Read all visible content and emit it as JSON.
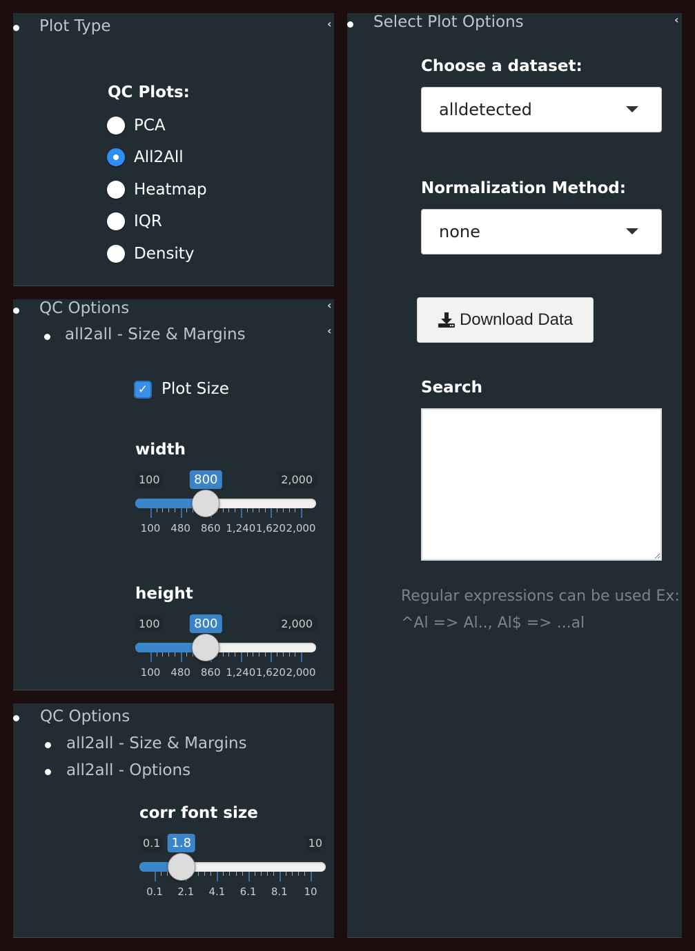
{
  "plot_type_panel": {
    "title": "Plot Type",
    "collapse_icon": "chevron-left-icon",
    "radio_group_label": "QC Plots:",
    "options": [
      {
        "label": "PCA",
        "checked": false
      },
      {
        "label": "All2All",
        "checked": true
      },
      {
        "label": "Heatmap",
        "checked": false
      },
      {
        "label": "IQR",
        "checked": false
      },
      {
        "label": "Density",
        "checked": false
      }
    ]
  },
  "qc_options_panel_1": {
    "title": "QC Options",
    "subitems": [
      "all2all - Size & Margins"
    ],
    "plot_size_checkbox": {
      "label": "Plot Size",
      "checked": true,
      "check_glyph": "✓"
    },
    "width_slider": {
      "label": "width",
      "min": 100,
      "max": 2000,
      "value": 800,
      "min_label": "100",
      "max_label": "2,000",
      "value_label": "800",
      "ticks": [
        "100",
        "480",
        "860",
        "1,240",
        "1,620",
        "2,000"
      ]
    },
    "height_slider": {
      "label": "height",
      "min": 100,
      "max": 2000,
      "value": 800,
      "min_label": "100",
      "max_label": "2,000",
      "value_label": "800",
      "ticks": [
        "100",
        "480",
        "860",
        "1,240",
        "1,620",
        "2,000"
      ]
    }
  },
  "qc_options_panel_2": {
    "title": "QC Options",
    "subitems": [
      "all2all - Size & Margins",
      "all2all - Options"
    ],
    "corr_font_slider": {
      "label": "corr font size",
      "min": 0.1,
      "max": 10,
      "value": 1.8,
      "min_label": "0.1",
      "max_label": "10",
      "value_label": "1.8",
      "ticks": [
        "0.1",
        "2.1",
        "4.1",
        "6.1",
        "8.1",
        "10"
      ]
    }
  },
  "select_plot_panel": {
    "title": "Select Plot Options",
    "dataset_label": "Choose a dataset:",
    "dataset_value": "alldetected",
    "normalization_label": "Normalization Method:",
    "normalization_value": "none",
    "download_button": {
      "label": "Download Data",
      "icon": "download-icon"
    },
    "search_label": "Search",
    "search_value": "",
    "help_text_line1": "Regular expressions can be used Ex:",
    "help_text_line2": "^Al => Al.., Al$ => ...al"
  },
  "colors": {
    "page_bg": "#1c0e0e",
    "panel_bg": "#222d33",
    "accent_blue": "#2f8cf0",
    "slider_fill": "#3a86cb",
    "muted_text": "#79838a"
  }
}
